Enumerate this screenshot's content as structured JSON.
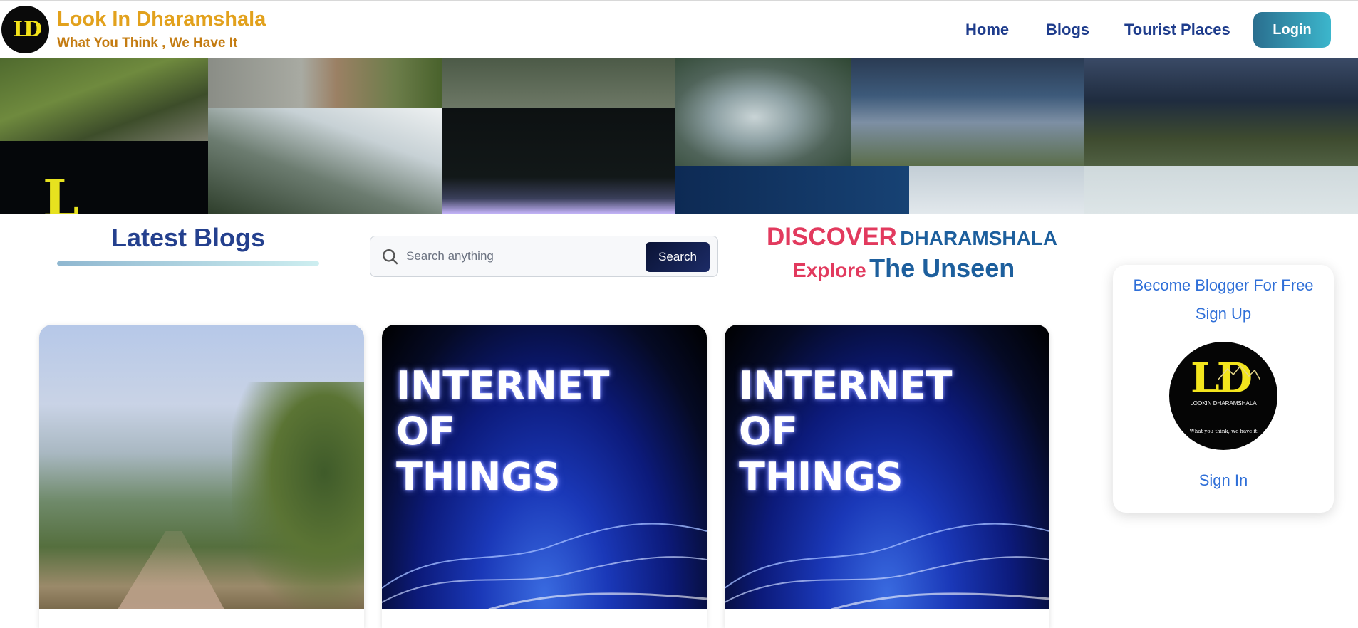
{
  "brand": {
    "logo_initials": "LD",
    "title": "Look In Dharamshala",
    "tagline": "What You Think , We Have It"
  },
  "nav": {
    "home": "Home",
    "blogs": "Blogs",
    "tourist_places": "Tourist Places",
    "login": "Login"
  },
  "blogs_section": {
    "heading": "Latest Blogs"
  },
  "search": {
    "placeholder": "Search anything",
    "button": "Search"
  },
  "discover": {
    "word1": "DISCOVER",
    "word2": "DHARAMSHALA",
    "word3": "Explore",
    "word4": "The Unseen"
  },
  "signup_card": {
    "become_blogger": "Become Blogger For Free",
    "sign_up": "Sign Up",
    "logo_brand": "LOOKIN DHARAMSHALA",
    "logo_tagline": "What you think, we have it",
    "sign_in": "Sign In"
  },
  "blog_cards": [
    {
      "image": "mountain-trail-photo"
    },
    {
      "image": "internet-of-things-banner",
      "overlay": [
        "INTERNET",
        "OF",
        "THINGS"
      ]
    },
    {
      "image": "internet-of-things-banner",
      "overlay": [
        "INTERNET",
        "OF",
        "THINGS"
      ]
    }
  ],
  "colors": {
    "brand_gold": "#e2a11c",
    "nav_blue": "#1e3c8c",
    "accent_red": "#e23a5e",
    "accent_blue": "#1d5f9d",
    "link_blue": "#2f6fd8"
  }
}
